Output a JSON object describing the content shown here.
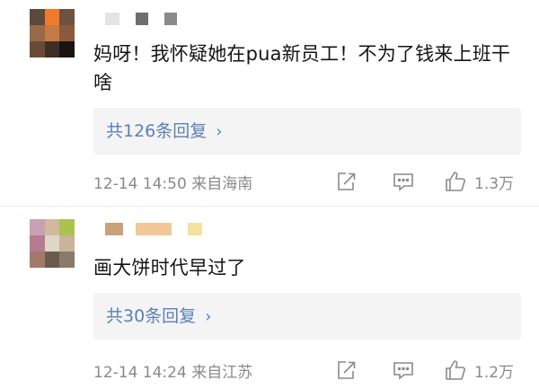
{
  "comments": [
    {
      "text": "妈呀！我怀疑她在pua新员工！不为了钱来上班干啥",
      "replies_label": "共126条回复",
      "chevron": "›",
      "meta": "12-14 14:50 来自海南",
      "like_count": "1.3万",
      "avatar_pixels": [
        "#5a4a3c",
        "#f07a2a",
        "#6d5240",
        "#9a6a48",
        "#c47b45",
        "#8a5a3a",
        "#6a4a36",
        "#3e2e26",
        "#1a1410"
      ],
      "name_blocks": [
        "#e4e4e4",
        "#ffffff",
        "#6e6e6e",
        "#ffffff",
        "#8a8a8a"
      ]
    },
    {
      "text": "画大饼时代早过了",
      "replies_label": "共30条回复",
      "chevron": "›",
      "meta": "12-14 14:24 来自江苏",
      "like_count": "1.2万",
      "avatar_pixels": [
        "#c9a0b4",
        "#d4b7a0",
        "#a9c44e",
        "#b87a90",
        "#e0d6c8",
        "#c8b49a",
        "#a27a6a",
        "#6a5a4e",
        "#8a7a6a"
      ],
      "name_blocks": [
        "#c8a27a",
        "#ffffff",
        "#f0c89a",
        "#ffffff",
        "#f5e1a0"
      ]
    }
  ],
  "icons": {
    "share": "share-icon",
    "comment": "comment-icon",
    "like": "thumbs-up-icon"
  }
}
